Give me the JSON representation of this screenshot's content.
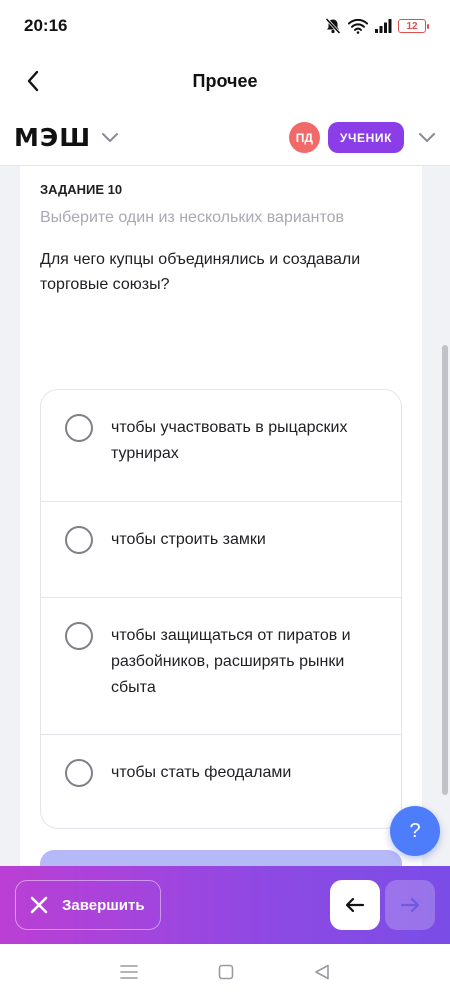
{
  "status_bar": {
    "time": "20:16",
    "battery": "12"
  },
  "nav": {
    "title": "Прочее"
  },
  "header": {
    "logo": "МЭШ",
    "avatar_initials": "ПД",
    "role": "УЧЕНИК"
  },
  "task": {
    "label": "ЗАДАНИЕ 10",
    "hint": "Выберите один из нескольких вариантов",
    "question": "Для чего купцы объединялись и создавали торговые союзы?"
  },
  "options": [
    {
      "text": "чтобы участвовать в рыцарских турнирах"
    },
    {
      "text": "чтобы строить замки"
    },
    {
      "text": "чтобы защищаться от пиратов и разбойников, расширять рынки сбыта"
    },
    {
      "text": "чтобы стать феодалами"
    }
  ],
  "help": {
    "label": "?"
  },
  "bottom": {
    "finish_label": "Завершить"
  },
  "colors": {
    "accent_purple": "#8b3ee8",
    "help_blue": "#4d7dfa",
    "avatar_red": "#f06a6a",
    "bar_gradient_start": "#bb3fd4",
    "bar_gradient_end": "#7a4de6"
  },
  "icons": {
    "back": "chevron-left-icon",
    "dropdown": "chevron-down-icon",
    "finish": "close-icon",
    "prev": "arrow-left-icon",
    "next": "arrow-right-icon",
    "mute": "bell-off-icon",
    "wifi": "wifi-icon",
    "signal": "signal-icon"
  }
}
